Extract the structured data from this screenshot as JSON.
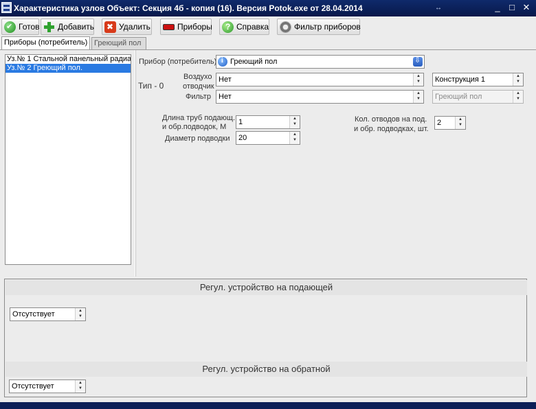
{
  "window": {
    "title": "Характеристика узлов  Объект: Секция 4б - копия (16). Версия Potok.exe от 28.04.2014",
    "resize_glyph": "↔",
    "min_glyph": "_",
    "max_glyph": "□",
    "close_glyph": "✕"
  },
  "toolbar": {
    "ready": "Готов",
    "add": "Добавить",
    "delete": "Удалить",
    "devices": "Приборы",
    "help": "Справка",
    "filter": "Фильтр приборов"
  },
  "tabs": [
    "Приборы (потребитель)",
    "Греющий пол"
  ],
  "nodes": [
    "Уз.№ 1 Стальной панельный радиа",
    "Уз.№ 2 Греющий пол."
  ],
  "form": {
    "device_label": "Прибор (потребитель)",
    "device_value": "Греющий пол",
    "type_label": "Тип - 0",
    "air_label_1": "Воздухо",
    "air_label_2": "отводчик",
    "air_value": "Нет",
    "filter_label": "Фильтр",
    "filter_value": "Нет",
    "construction_value": "Конструкция 1",
    "floor_value": "Греющий пол",
    "length_label_1": "Длина труб подающ.",
    "length_label_2": "и обр.подводок,  М",
    "length_value": "1",
    "diameter_label": "Диаметр подводки",
    "diameter_value": "20",
    "bends_label_1": "Кол. отводов на  под.",
    "bends_label_2": "и обр. подводках, шт.",
    "bends_value": "2"
  },
  "regulators": {
    "supply_title": "Регул. устройство на подающей",
    "supply_value": "Отсутствует",
    "return_title": "Регул. устройство на обратной",
    "return_value": "Отсутствует"
  },
  "colors": {
    "titlebar": "#0f2a6b",
    "selection": "#2a7ae2",
    "window_bg": "#ececec"
  }
}
